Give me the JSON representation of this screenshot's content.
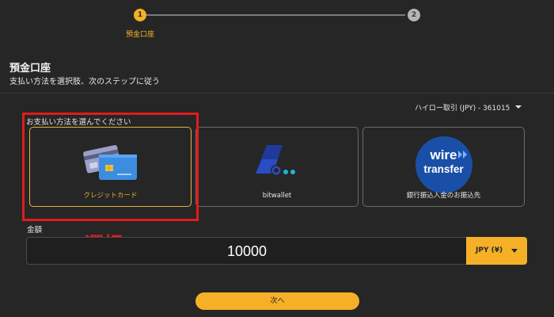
{
  "stepper": {
    "step1": "1",
    "step2": "2",
    "step1_label": "預金口座"
  },
  "header": {
    "title": "預金口座",
    "subtitle": "支払い方法を選択肢、次のステップに従う"
  },
  "account": {
    "selected": "ハイロー取引 (JPY) - 361015"
  },
  "payment": {
    "label": "お支払い方法を選んでください",
    "methods": [
      {
        "name": "クレジットカード",
        "icon": "credit-card-icon"
      },
      {
        "name": "bitwallet",
        "icon": "bitwallet-logo"
      },
      {
        "name": "銀行振込入金のお振込先",
        "icon": "wire-transfer-logo"
      }
    ],
    "wire_logo_line1": "wire",
    "wire_logo_line2": "transfer"
  },
  "annotation": {
    "text": "選択"
  },
  "amount": {
    "label": "金額",
    "value": "10000",
    "currency": "JPY (¥)"
  },
  "actions": {
    "next_label": "次へ"
  },
  "colors": {
    "accent": "#f5b027",
    "highlight": "#e11b1b",
    "background": "#262626"
  }
}
